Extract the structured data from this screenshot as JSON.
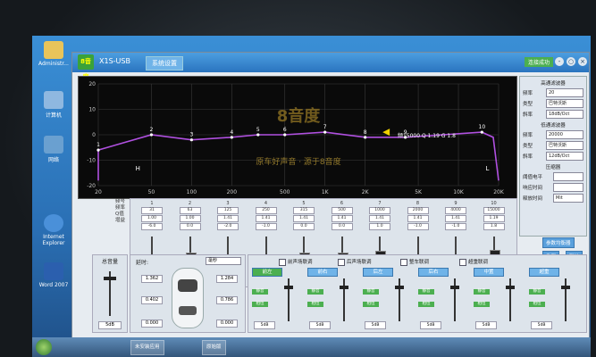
{
  "desktop": {
    "icons": [
      "Administr...",
      "计算机",
      "网络",
      "Internet Explorer",
      "Word 2007"
    ]
  },
  "app": {
    "title": "X1S-USB",
    "logo_text": "8音度",
    "tab": "系统设置",
    "connection": "连接成功",
    "window_buttons": [
      "-",
      "○",
      "×"
    ]
  },
  "chart_data": {
    "type": "line",
    "x_ticks": [
      "20",
      "50",
      "100",
      "200",
      "500",
      "1K",
      "2K",
      "5K",
      "10K",
      "20K"
    ],
    "y_ticks": [
      "-20",
      "-10",
      "0",
      "10",
      "20"
    ],
    "ylim": [
      -20,
      20
    ],
    "points": [
      {
        "label": "1",
        "x": 20,
        "y": -6
      },
      {
        "label": "2",
        "x": 50,
        "y": 0
      },
      {
        "label": "3",
        "x": 100,
        "y": -2
      },
      {
        "label": "4",
        "x": 200,
        "y": -1
      },
      {
        "label": "5",
        "x": 315,
        "y": 0
      },
      {
        "label": "6",
        "x": 500,
        "y": 0
      },
      {
        "label": "7",
        "x": 1000,
        "y": 1
      },
      {
        "label": "8",
        "x": 2000,
        "y": -1
      },
      {
        "label": "9",
        "x": 4000,
        "y": -1
      },
      {
        "label": "10",
        "x": 15000,
        "y": 1
      }
    ],
    "markers": {
      "left": "H",
      "right": "L"
    },
    "info_text": "频15000 Q 1.19 G 1.8",
    "watermark": "8音度",
    "slogan": "原车好声音 · 源于8音度",
    "line_color": "#b050e0"
  },
  "right_panel": {
    "hp_title": "高通滤波器",
    "hp_freq_label": "频率",
    "hp_freq": "20",
    "hp_type_label": "类型",
    "hp_type": "巴特沃斯",
    "hp_slope_label": "斜率",
    "hp_slope": "18dB/Oct",
    "lp_title": "低通滤波器",
    "lp_freq_label": "频率",
    "lp_freq": "20000",
    "lp_type_label": "类型",
    "lp_type": "巴特沃斯",
    "lp_slope_label": "斜率",
    "lp_slope": "12dB/Oct",
    "comp_title": "压缩器",
    "comp_thresh_label": "阈值电平",
    "comp_attack_label": "响应时间",
    "comp_release_label": "释放时间",
    "comp_release_val": "Mit",
    "dist_button": "参数均衡器",
    "btn_reset": "重置",
    "btn_default": "默认"
  },
  "band_row_labels": [
    "频号",
    "频率",
    "Q值",
    "增益"
  ],
  "bands": [
    {
      "num": "1",
      "freq": "31",
      "q": "1.00",
      "gain": "-6.0"
    },
    {
      "num": "2",
      "freq": "63",
      "q": "1.00",
      "gain": "0.0"
    },
    {
      "num": "3",
      "freq": "125",
      "q": "1.41",
      "gain": "-2.0"
    },
    {
      "num": "4",
      "freq": "250",
      "q": "1.41",
      "gain": "-1.0"
    },
    {
      "num": "5",
      "freq": "315",
      "q": "1.41",
      "gain": "0.0"
    },
    {
      "num": "6",
      "freq": "500",
      "q": "1.41",
      "gain": "0.0"
    },
    {
      "num": "7",
      "freq": "1000",
      "q": "1.41",
      "gain": "1.0"
    },
    {
      "num": "8",
      "freq": "2000",
      "q": "1.41",
      "gain": "-1.0"
    },
    {
      "num": "9",
      "freq": "4000",
      "q": "1.41",
      "gain": "-1.0"
    },
    {
      "num": "10",
      "freq": "15000",
      "q": "1.19",
      "gain": "1.8"
    }
  ],
  "volume": {
    "label": "总音量",
    "value": "5dB"
  },
  "delay": {
    "label": "延时:",
    "unit": "毫秒",
    "values": [
      "1.362",
      "1.284",
      "0.402",
      "0.786",
      "0.000",
      "0.000"
    ]
  },
  "links": [
    "前声场联调",
    "后声场联调",
    "整车联调",
    "超重联调"
  ],
  "channels": [
    {
      "name": "前左",
      "value": "5dB"
    },
    {
      "name": "前右",
      "value": "5dB"
    },
    {
      "name": "后左",
      "value": "5dB"
    },
    {
      "name": "后右",
      "value": "5dB"
    },
    {
      "name": "中置",
      "value": "5dB"
    },
    {
      "name": "超重",
      "value": "5dB"
    }
  ],
  "channel_button_labels": [
    "静音",
    "相位"
  ],
  "taskbar": {
    "items": [
      "未安装应用",
      "原始版"
    ]
  }
}
